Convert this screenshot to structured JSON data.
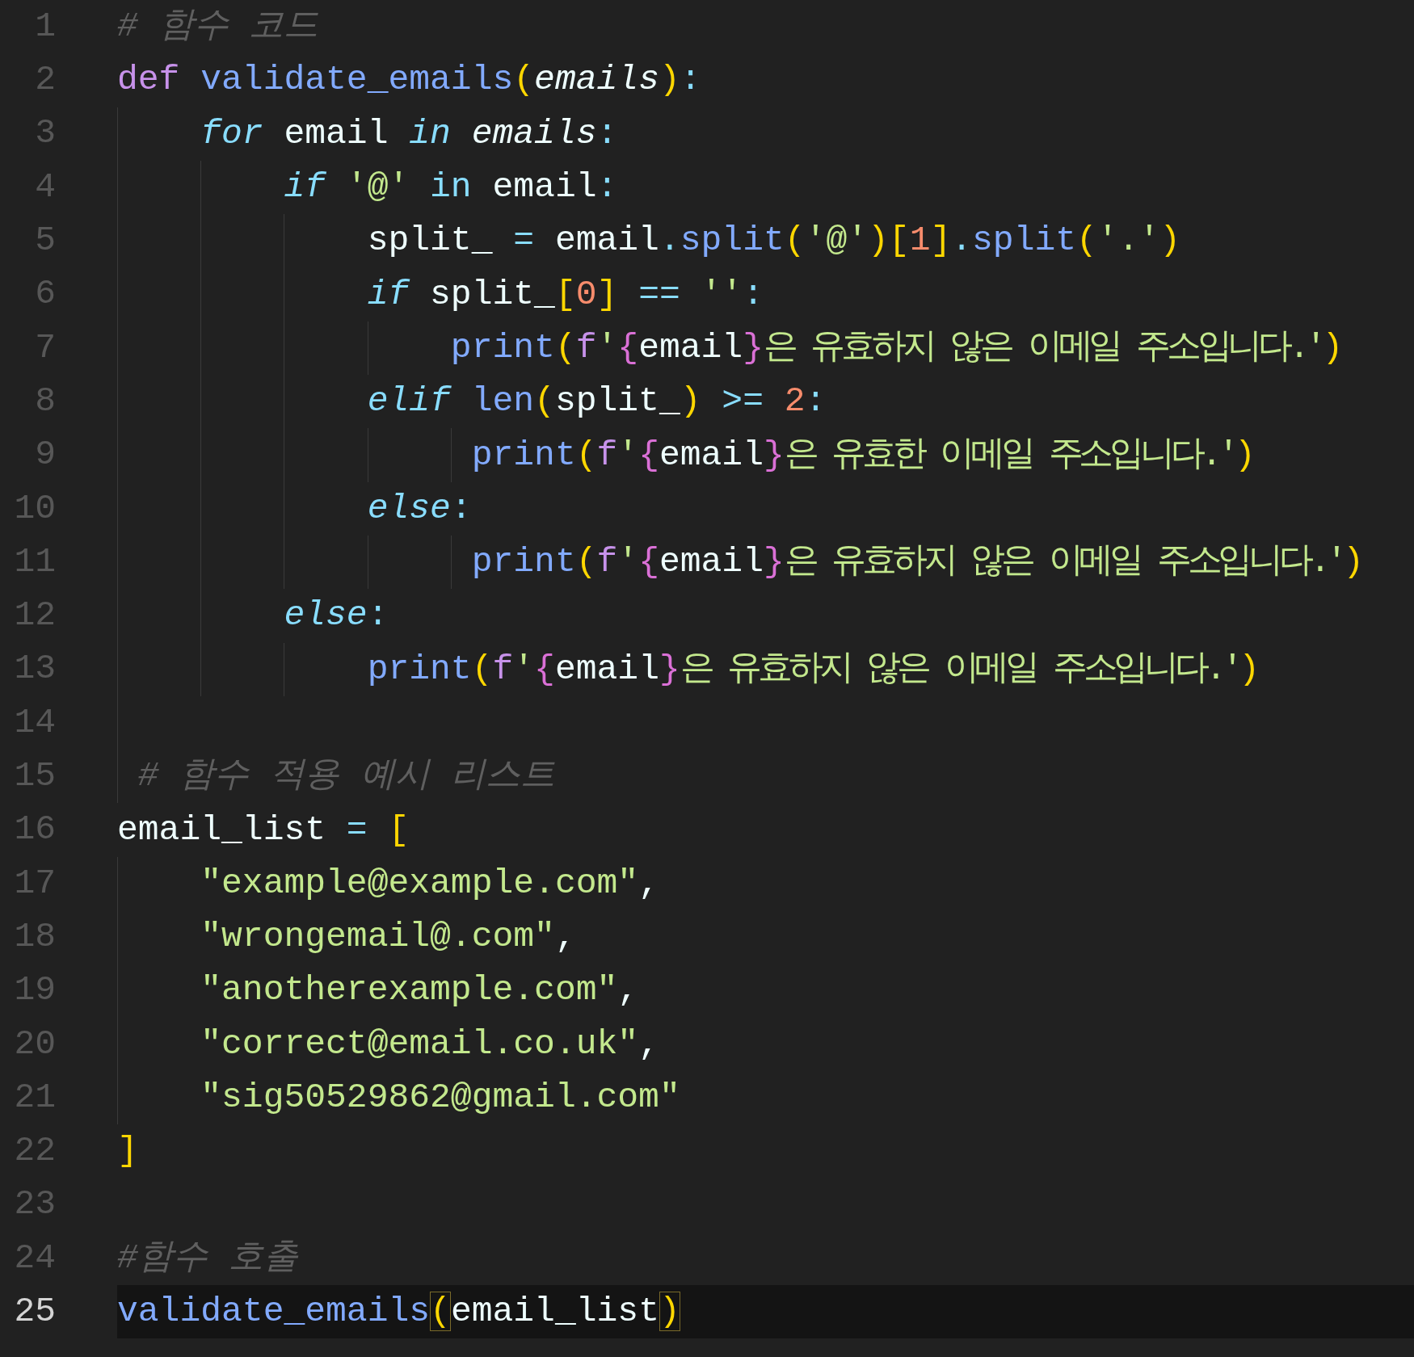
{
  "editor": {
    "lines": [
      {
        "number": "1",
        "current": false,
        "tokens": [
          {
            "text": "# 함수 코드",
            "kind": "comment"
          }
        ]
      },
      {
        "number": "2",
        "current": false,
        "tokens": [
          {
            "text": "def ",
            "kind": "keyword"
          },
          {
            "text": "validate_emails",
            "kind": "function"
          },
          {
            "text": "(",
            "kind": "bracket"
          },
          {
            "text": "emails",
            "kind": "param"
          },
          {
            "text": ")",
            "kind": "bracket"
          },
          {
            "text": ":",
            "kind": "punct"
          }
        ]
      },
      {
        "number": "3",
        "current": false,
        "tokens": [
          {
            "text": "    for",
            "kind": "control"
          },
          {
            "text": " email ",
            "kind": "var"
          },
          {
            "text": "in",
            "kind": "control"
          },
          {
            "text": " emails",
            "kind": "param"
          },
          {
            "text": ":",
            "kind": "punct"
          }
        ]
      },
      {
        "number": "4",
        "current": false,
        "tokens": [
          {
            "text": "        if",
            "kind": "control"
          },
          {
            "text": " '@'",
            "kind": "string"
          },
          {
            "text": " in",
            "kind": "op"
          },
          {
            "text": " email",
            "kind": "var"
          },
          {
            "text": ":",
            "kind": "punct"
          }
        ]
      },
      {
        "number": "5",
        "current": false,
        "tokens": [
          {
            "text": "            split_",
            "kind": "var"
          },
          {
            "text": " =",
            "kind": "op"
          },
          {
            "text": " email",
            "kind": "var"
          },
          {
            "text": ".",
            "kind": "punct"
          },
          {
            "text": "split",
            "kind": "function"
          },
          {
            "text": "(",
            "kind": "bracket"
          },
          {
            "text": "'@'",
            "kind": "string"
          },
          {
            "text": ")",
            "kind": "bracket"
          },
          {
            "text": "[",
            "kind": "bracket"
          },
          {
            "text": "1",
            "kind": "number"
          },
          {
            "text": "]",
            "kind": "bracket"
          },
          {
            "text": ".",
            "kind": "punct"
          },
          {
            "text": "split",
            "kind": "function"
          },
          {
            "text": "(",
            "kind": "bracket"
          },
          {
            "text": "'.'",
            "kind": "string"
          },
          {
            "text": ")",
            "kind": "bracket"
          }
        ]
      },
      {
        "number": "6",
        "current": false,
        "tokens": [
          {
            "text": "            if",
            "kind": "control"
          },
          {
            "text": " split_",
            "kind": "var"
          },
          {
            "text": "[",
            "kind": "bracket"
          },
          {
            "text": "0",
            "kind": "number"
          },
          {
            "text": "]",
            "kind": "bracket"
          },
          {
            "text": " ==",
            "kind": "op"
          },
          {
            "text": " ''",
            "kind": "string"
          },
          {
            "text": ":",
            "kind": "punct"
          }
        ]
      },
      {
        "number": "7",
        "current": false,
        "tokens": [
          {
            "text": "                print",
            "kind": "function"
          },
          {
            "text": "(",
            "kind": "bracket"
          },
          {
            "text": "f",
            "kind": "fprefix"
          },
          {
            "text": "'",
            "kind": "string"
          },
          {
            "text": "{",
            "kind": "brace"
          },
          {
            "text": "email",
            "kind": "var"
          },
          {
            "text": "}",
            "kind": "brace"
          },
          {
            "text": "은 유효하지 않은 이메일 주소입니다.'",
            "kind": "string"
          },
          {
            "text": ")",
            "kind": "bracket"
          }
        ]
      },
      {
        "number": "8",
        "current": false,
        "tokens": [
          {
            "text": "            elif",
            "kind": "control"
          },
          {
            "text": " len",
            "kind": "function"
          },
          {
            "text": "(",
            "kind": "bracket"
          },
          {
            "text": "split_",
            "kind": "var"
          },
          {
            "text": ")",
            "kind": "bracket"
          },
          {
            "text": " >=",
            "kind": "op"
          },
          {
            "text": " 2",
            "kind": "number"
          },
          {
            "text": ":",
            "kind": "punct"
          }
        ]
      },
      {
        "number": "9",
        "current": false,
        "tokens": [
          {
            "text": "                 print",
            "kind": "function"
          },
          {
            "text": "(",
            "kind": "bracket"
          },
          {
            "text": "f",
            "kind": "fprefix"
          },
          {
            "text": "'",
            "kind": "string"
          },
          {
            "text": "{",
            "kind": "brace"
          },
          {
            "text": "email",
            "kind": "var"
          },
          {
            "text": "}",
            "kind": "brace"
          },
          {
            "text": "은 유효한 이메일 주소입니다.'",
            "kind": "string"
          },
          {
            "text": ")",
            "kind": "bracket"
          }
        ]
      },
      {
        "number": "10",
        "current": false,
        "tokens": [
          {
            "text": "            else",
            "kind": "control"
          },
          {
            "text": ":",
            "kind": "punct"
          }
        ]
      },
      {
        "number": "11",
        "current": false,
        "tokens": [
          {
            "text": "                 print",
            "kind": "function"
          },
          {
            "text": "(",
            "kind": "bracket"
          },
          {
            "text": "f",
            "kind": "fprefix"
          },
          {
            "text": "'",
            "kind": "string"
          },
          {
            "text": "{",
            "kind": "brace"
          },
          {
            "text": "email",
            "kind": "var"
          },
          {
            "text": "}",
            "kind": "brace"
          },
          {
            "text": "은 유효하지 않은 이메일 주소입니다.'",
            "kind": "string"
          },
          {
            "text": ")",
            "kind": "bracket"
          }
        ]
      },
      {
        "number": "12",
        "current": false,
        "tokens": [
          {
            "text": "        else",
            "kind": "control"
          },
          {
            "text": ":",
            "kind": "punct"
          }
        ]
      },
      {
        "number": "13",
        "current": false,
        "tokens": [
          {
            "text": "            print",
            "kind": "function"
          },
          {
            "text": "(",
            "kind": "bracket"
          },
          {
            "text": "f",
            "kind": "fprefix"
          },
          {
            "text": "'",
            "kind": "string"
          },
          {
            "text": "{",
            "kind": "brace"
          },
          {
            "text": "email",
            "kind": "var"
          },
          {
            "text": "}",
            "kind": "brace"
          },
          {
            "text": "은 유효하지 않은 이메일 주소입니다.'",
            "kind": "string"
          },
          {
            "text": ")",
            "kind": "bracket"
          }
        ]
      },
      {
        "number": "14",
        "current": false
      },
      {
        "number": "15",
        "current": false,
        "tokens": [
          {
            "text": " # 함수 적용 예시 리스트",
            "kind": "comment"
          }
        ]
      },
      {
        "number": "16",
        "current": false,
        "tokens": [
          {
            "text": "email_list",
            "kind": "var"
          },
          {
            "text": " =",
            "kind": "op"
          },
          {
            "text": " [",
            "kind": "bracket"
          }
        ]
      },
      {
        "number": "17",
        "current": false,
        "tokens": [
          {
            "text": "    \"example@example.com\"",
            "kind": "string"
          },
          {
            "text": ",",
            "kind": "var"
          }
        ]
      },
      {
        "number": "18",
        "current": false,
        "tokens": [
          {
            "text": "    \"wrongemail@.com\"",
            "kind": "string"
          },
          {
            "text": ",",
            "kind": "var"
          }
        ]
      },
      {
        "number": "19",
        "current": false,
        "tokens": [
          {
            "text": "    \"anotherexample.com\"",
            "kind": "string"
          },
          {
            "text": ",",
            "kind": "var"
          }
        ]
      },
      {
        "number": "20",
        "current": false,
        "tokens": [
          {
            "text": "    \"correct@email.co.uk\"",
            "kind": "string"
          },
          {
            "text": ",",
            "kind": "var"
          }
        ]
      },
      {
        "number": "21",
        "current": false,
        "tokens": [
          {
            "text": "    \"sig50529862@gmail.com\"",
            "kind": "string"
          }
        ]
      },
      {
        "number": "22",
        "current": false,
        "tokens": [
          {
            "text": "]",
            "kind": "bracket"
          }
        ]
      },
      {
        "number": "23",
        "current": false
      },
      {
        "number": "24",
        "current": false,
        "tokens": [
          {
            "text": "#함수 호출",
            "kind": "comment"
          }
        ]
      },
      {
        "number": "25",
        "current": true,
        "tokens": [
          {
            "text": "validate_emails",
            "kind": "function"
          },
          {
            "text": "(",
            "kind": "match"
          },
          {
            "text": "email_list",
            "kind": "var"
          },
          {
            "text": ")",
            "kind": "match"
          }
        ]
      }
    ]
  }
}
